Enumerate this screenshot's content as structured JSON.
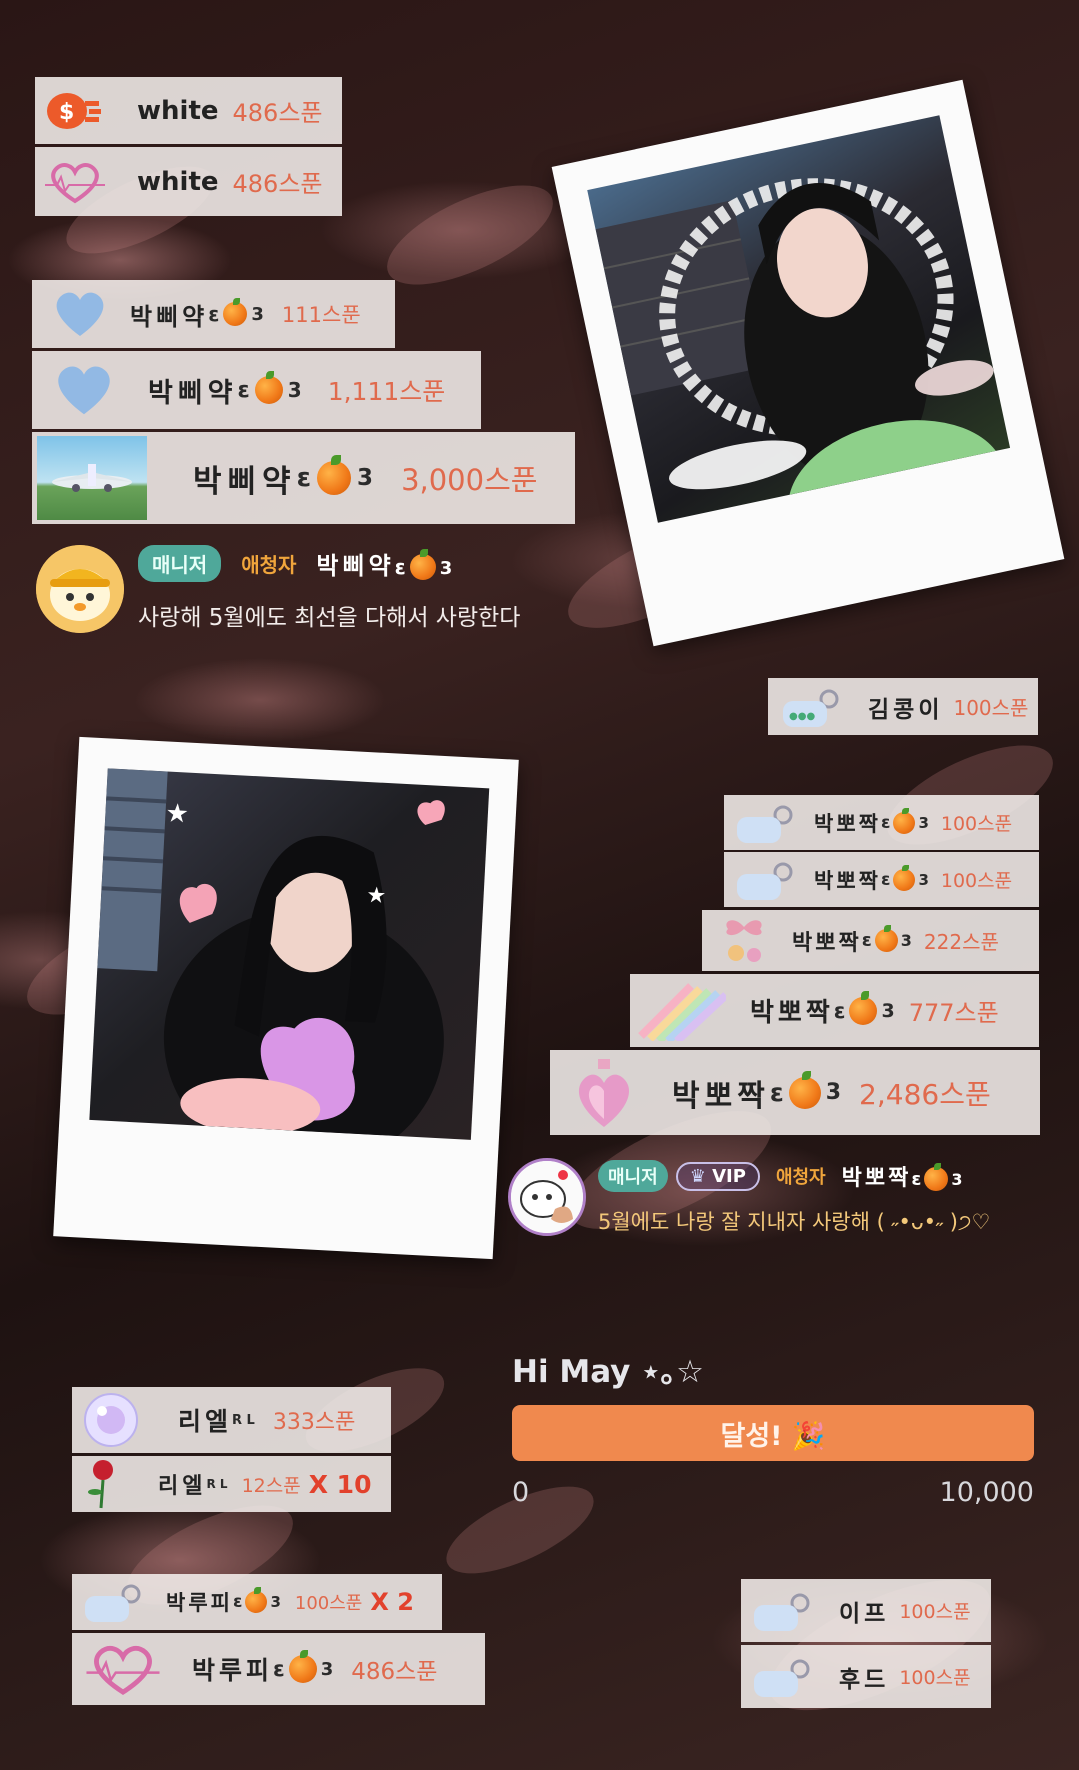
{
  "gifts": {
    "white1": {
      "name": "white",
      "amount": "486스푼",
      "icon": "spoon-sticker-icon"
    },
    "white2": {
      "name": "white",
      "amount": "486스푼",
      "icon": "heart-sticker-icon"
    },
    "bb1": {
      "name": "박삐약",
      "suffix": "ε",
      "num": "3",
      "amount": "111스푼",
      "icon": "blue-heart-icon"
    },
    "bb2": {
      "name": "박삐약",
      "suffix": "ε",
      "num": "3",
      "amount": "1,111스푼",
      "icon": "blue-heart-icon"
    },
    "bb3": {
      "name": "박삐약",
      "suffix": "ε",
      "num": "3",
      "amount": "3,000스푼",
      "icon": "airplane-icon"
    },
    "kim": {
      "name": "김콩이",
      "amount": "100스푼",
      "icon": "keyring-icon"
    },
    "bp1": {
      "name": "박뽀짝",
      "suffix": "ε",
      "num": "3",
      "amount": "100스푼",
      "icon": "keyring-icon"
    },
    "bp2": {
      "name": "박뽀짝",
      "suffix": "ε",
      "num": "3",
      "amount": "100스푼",
      "icon": "keyring-icon"
    },
    "bp3": {
      "name": "박뽀짝",
      "suffix": "ε",
      "num": "3",
      "amount": "222스푼",
      "icon": "ribbon-charm-icon"
    },
    "bp4": {
      "name": "박뽀짝",
      "suffix": "ε",
      "num": "3",
      "amount": "777스푼",
      "icon": "rainbow-icon"
    },
    "bp5": {
      "name": "박뽀짝",
      "suffix": "ε",
      "num": "3",
      "amount": "2,486스푼",
      "icon": "perfume-heart-icon"
    },
    "riel1": {
      "name": "리엘",
      "sup": "R L",
      "amount": "333스푼",
      "icon": "bubble-icon"
    },
    "riel2": {
      "name": "리엘",
      "sup": "R L",
      "amount": "12스푼",
      "mult": "X 10",
      "icon": "rose-icon"
    },
    "lp1": {
      "name": "박루피",
      "suffix": "ε",
      "num": "3",
      "amount": "100스푼",
      "mult": "X 2",
      "icon": "keyring-icon"
    },
    "lp2": {
      "name": "박루피",
      "suffix": "ε",
      "num": "3",
      "amount": "486스푼",
      "icon": "heart-sticker-icon"
    },
    "ife": {
      "name": "이프",
      "amount": "100스푼",
      "icon": "keyring-icon"
    },
    "hood": {
      "name": "후드",
      "amount": "100스푼",
      "icon": "keyring-icon"
    }
  },
  "chat1": {
    "tags": {
      "manager": "매니저",
      "listener": "애청자"
    },
    "name": "박삐약",
    "suffix": "ε",
    "num": "3",
    "message": "사랑해 5월에도 최선을 다해서 사랑한다"
  },
  "chat2": {
    "tags": {
      "manager": "매니저",
      "vip": "VIP",
      "listener": "애청자"
    },
    "name": "박뽀짝",
    "suffix": "ε",
    "num": "3",
    "message": "5월에도 나랑 잘 지내자 사랑해 ( ˶•ᴗ•˶ )੭♡"
  },
  "goal": {
    "title": "Hi May ⋆｡☆",
    "bar_label": "달성! 🎉",
    "min": "0",
    "max": "10,000",
    "progress": 1.0
  },
  "colors": {
    "amount": "#e06a4d",
    "multiplier": "#e2412c",
    "goal_bar": "#f0894e",
    "manager_tag": "#4fa89a",
    "listener_tag": "#f0a53c"
  }
}
